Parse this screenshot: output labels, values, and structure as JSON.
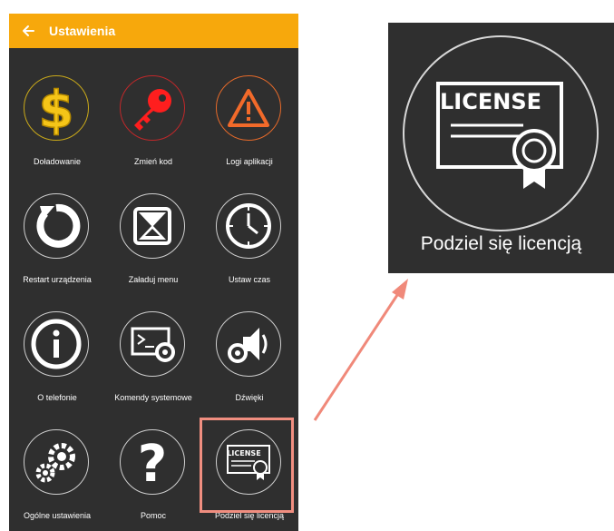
{
  "header": {
    "title": "Ustawienia",
    "back_icon": "arrow-left-icon"
  },
  "colors": {
    "accent": "#f7a80c",
    "panel": "#2f2f2f",
    "highlight": "#f08e80"
  },
  "tiles": [
    {
      "label": "Doładowanie",
      "icon": "dollar-icon"
    },
    {
      "label": "Zmień kod",
      "icon": "key-icon"
    },
    {
      "label": "Logi aplikacji",
      "icon": "warning-icon"
    },
    {
      "label": "Restart urządzenia",
      "icon": "restart-icon"
    },
    {
      "label": "Załaduj menu",
      "icon": "load-menu-icon"
    },
    {
      "label": "Ustaw czas",
      "icon": "clock-icon"
    },
    {
      "label": "O telefonie",
      "icon": "info-icon"
    },
    {
      "label": "Komendy systemowe",
      "icon": "terminal-gear-icon"
    },
    {
      "label": "Dźwięki",
      "icon": "speaker-gear-icon"
    },
    {
      "label": "Ogólne ustawienia",
      "icon": "gears-icon"
    },
    {
      "label": "Pomoc",
      "icon": "question-icon"
    },
    {
      "label": "Podziel się licencją",
      "icon": "license-icon"
    }
  ],
  "license_badge_text": "LICENSE",
  "zoom": {
    "label": "Podziel się licencją",
    "icon": "license-icon"
  }
}
